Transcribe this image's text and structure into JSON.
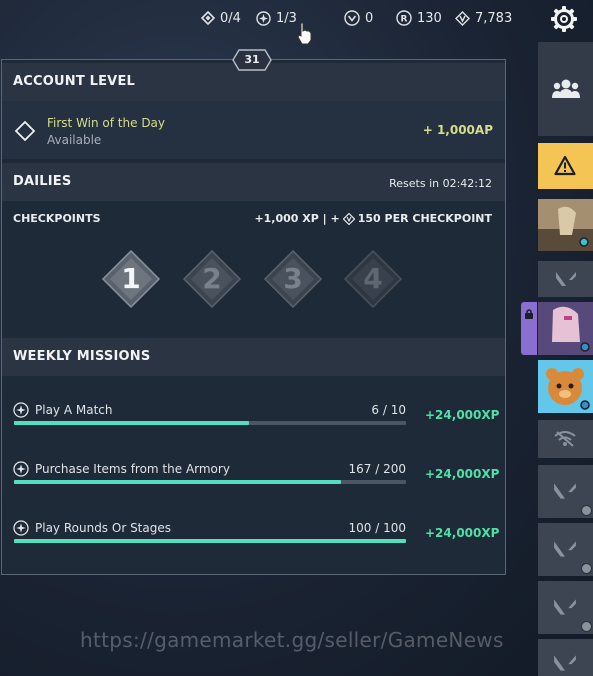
{
  "topbar": {
    "missions_count": "0/4",
    "checkpoint_count": "1/3",
    "kingdom_credits": "0",
    "radianite": "130",
    "valorant_points": "7,783"
  },
  "level_badge": "31",
  "account_level": {
    "title": "ACCOUNT LEVEL",
    "first_win_title": "First Win of the Day",
    "first_win_status": "Available",
    "first_win_reward": "+ 1,000AP"
  },
  "dailies": {
    "title": "DAILIES",
    "resets": "Resets in 02:42:12",
    "checkpoints_label": "CHECKPOINTS",
    "reward_prefix": "+1,000 XP | +",
    "reward_suffix": "150 PER CHECKPOINT",
    "checkpoints": [
      {
        "label": "1",
        "completed": true
      },
      {
        "label": "2",
        "completed": false
      },
      {
        "label": "3",
        "completed": false
      },
      {
        "label": "4",
        "completed": false
      }
    ]
  },
  "weekly": {
    "title": "WEEKLY MISSIONS",
    "missions": [
      {
        "name": "Play A Match",
        "progress": "6 / 10",
        "fraction": 0.6,
        "reward": "+24,000XP"
      },
      {
        "name": "Purchase Items from the Armory",
        "progress": "167 / 200",
        "fraction": 0.835,
        "reward": "+24,000XP"
      },
      {
        "name": "Play Rounds Or Stages",
        "progress": "100 / 100",
        "fraction": 1.0,
        "reward": "+24,000XP"
      }
    ]
  },
  "watermark": "https://gamemarket.gg/seller/GameNews",
  "colors": {
    "accent_green": "#4fe0a8",
    "accent_yellow": "#d6dd8c",
    "warning": "#f4c554",
    "panel": "#1f2a38"
  },
  "icons": {
    "gear": "settings-gear-icon",
    "friends": "friends-group-icon",
    "warning": "warning-triangle-icon"
  }
}
